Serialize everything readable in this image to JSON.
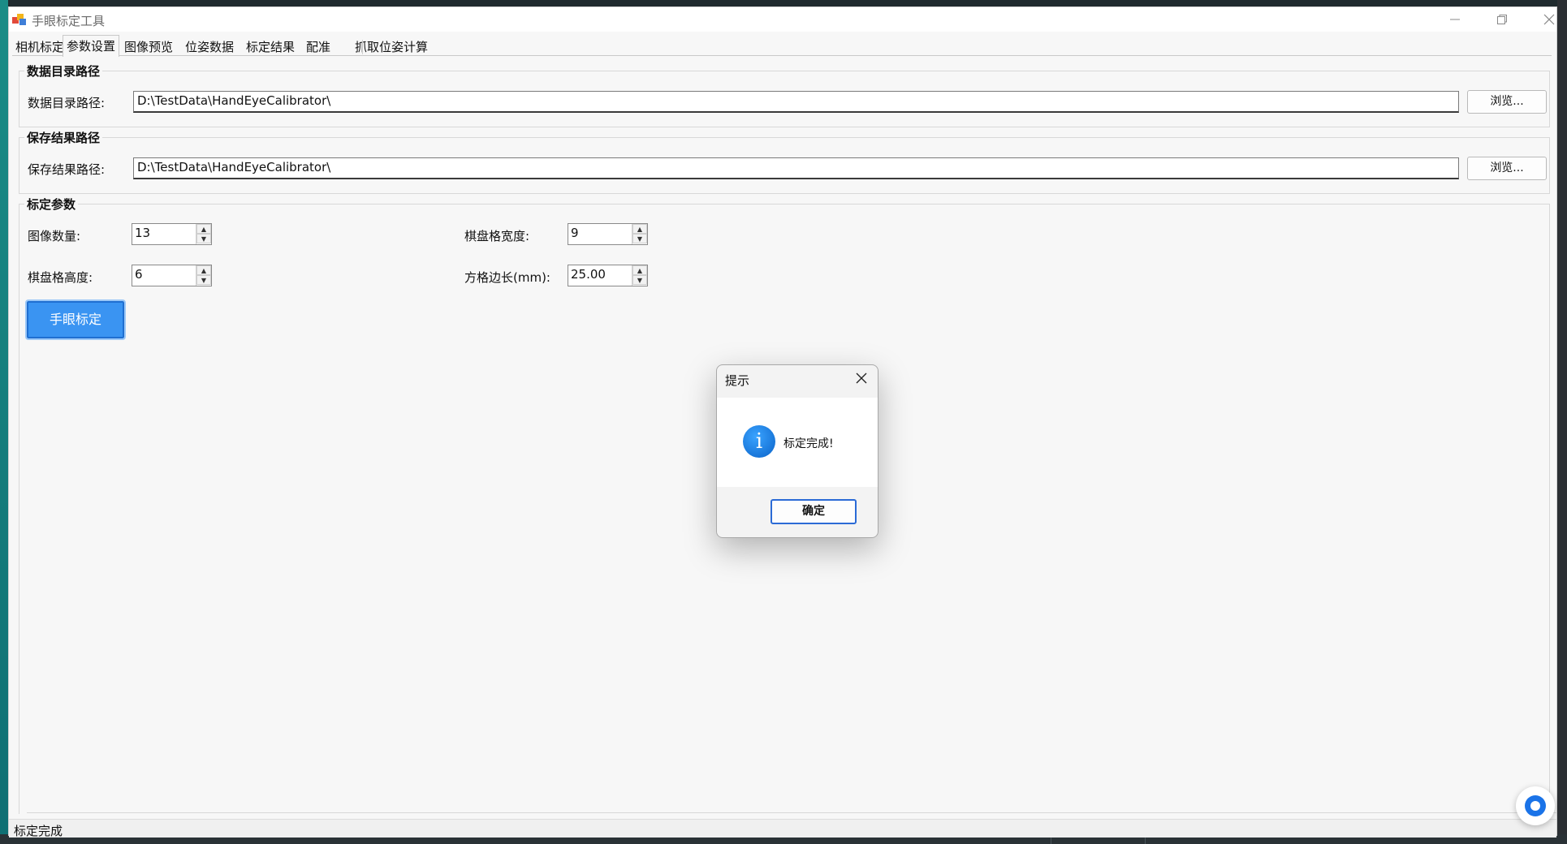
{
  "window": {
    "title": "手眼标定工具"
  },
  "tabs": [
    {
      "label": "相机标定"
    },
    {
      "label": "参数设置"
    },
    {
      "label": "图像预览"
    },
    {
      "label": "位姿数据"
    },
    {
      "label": "标定结果"
    },
    {
      "label": "配准"
    },
    {
      "label": "抓取位姿计算"
    }
  ],
  "active_tab": "参数设置",
  "data_dir_group": {
    "title": "数据目录路径",
    "label": "数据目录路径:",
    "value": "D:\\TestData\\HandEyeCalibrator\\",
    "browse_label": "浏览..."
  },
  "save_dir_group": {
    "title": "保存结果路径",
    "label": "保存结果路径:",
    "value": "D:\\TestData\\HandEyeCalibrator\\",
    "browse_label": "浏览..."
  },
  "calib_params": {
    "title": "标定参数",
    "image_count_label": "图像数量:",
    "image_count": "13",
    "board_width_label": "棋盘格宽度:",
    "board_width": "9",
    "board_height_label": "棋盘格高度:",
    "board_height": "6",
    "square_size_label": "方格边长(mm):",
    "square_size": "25.00"
  },
  "calibrate_button": "手眼标定",
  "dialog": {
    "title": "提示",
    "icon": "info-icon",
    "message": "标定完成!",
    "ok_label": "确定"
  },
  "status": {
    "text": "标定完成"
  },
  "colors": {
    "accent": "#3a94f2",
    "dialog_button_border": "#2b6bd6",
    "info_icon": "#1a73e8"
  }
}
